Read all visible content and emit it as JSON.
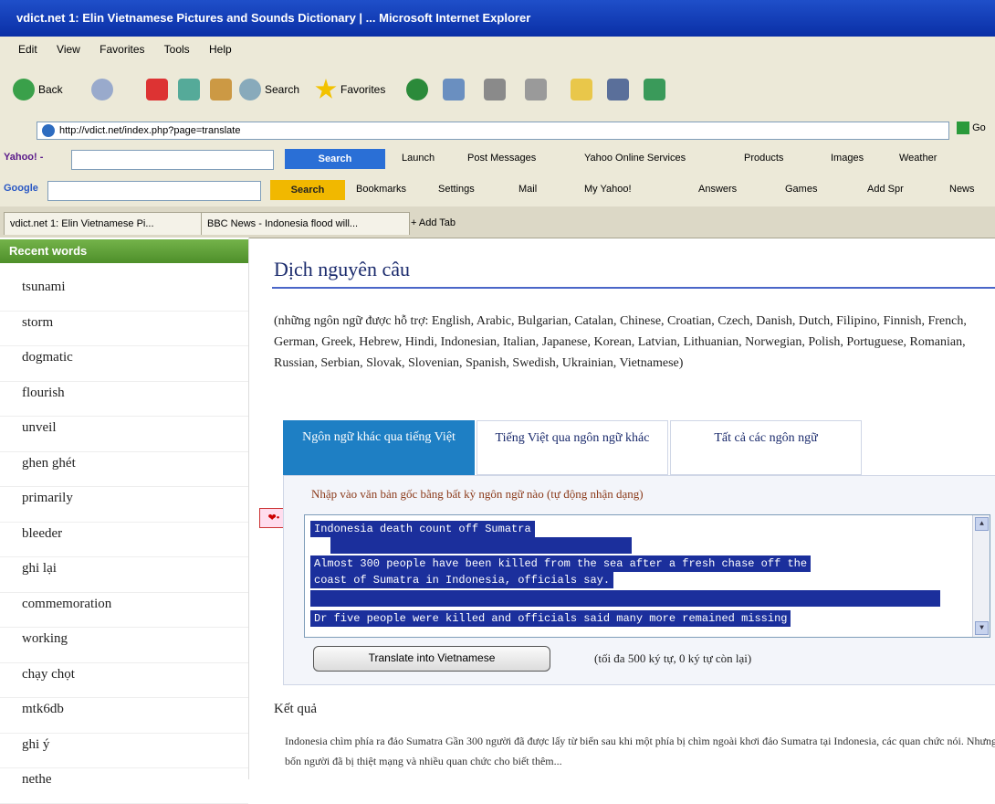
{
  "window": {
    "title": "vdict.net 1: Elin Vietnamese Pictures and Sounds Dictionary | ... Microsoft Internet Explorer"
  },
  "menu": [
    "Edit",
    "View",
    "Favorites",
    "Tools",
    "Help"
  ],
  "toolbar": {
    "back_label": "Back",
    "search_label": "Search",
    "favorites_label": "Favorites"
  },
  "address": {
    "url": "http://vdict.net/index.php?page=translate",
    "go_label": "Go"
  },
  "yahoo": {
    "label": "Yahoo! -",
    "search_button": "Search",
    "items": [
      "Launch",
      "Post Messages",
      "Yahoo Online Services",
      "Products",
      "Images",
      "Weather"
    ]
  },
  "google": {
    "label": "Google",
    "search_button": "Search",
    "items": [
      "Bookmarks",
      "Settings",
      "Mail",
      "My Yahoo!",
      "Answers",
      "Games",
      "Add Spr",
      "News"
    ]
  },
  "tabs_bar": {
    "tabs": [
      "vdict.net 1: Elin Vietnamese Pi...",
      "BBC News - Indonesia flood will..."
    ],
    "add_tab": "Add Tab"
  },
  "sidebar": {
    "heading": "Recent words",
    "words": [
      "tsunami",
      "storm",
      "dogmatic",
      "flourish",
      "unveil",
      "ghen ghét",
      "primarily",
      "bleeder",
      "ghi lại",
      "commemoration",
      "working",
      "chạy chọt",
      "mtk6db",
      "ghi ý",
      "nethe"
    ]
  },
  "main": {
    "title": "Dịch nguyên câu",
    "intro": "(những ngôn ngữ được hỗ trợ: English, Arabic, Bulgarian, Catalan, Chinese, Croatian, Czech, Danish, Dutch, Filipino, Finnish, French, German, Greek, Hebrew, Hindi, Indonesian, Italian, Japanese, Korean, Latvian, Lithuanian, Norwegian, Polish, Portuguese, Romanian, Russian, Serbian, Slovak, Slovenian, Spanish, Swedish, Ukrainian, Vietnamese)",
    "tabs": [
      "Ngôn ngữ khác qua tiếng Việt",
      "Tiếng Việt qua ngôn ngữ khác",
      "Tất cả các ngôn ngữ"
    ],
    "instruction": "Nhập vào văn bản gốc bằng bất kỳ ngôn ngữ nào (tự động nhận dạng)",
    "textarea_lines": [
      "Indonesia death count off Sumatra",
      "Almost 300 people have been killed from the sea after a fresh chase off the",
      "coast of Sumatra in Indonesia, officials say.",
      "Dr five people were killed and officials said many more remained missing"
    ],
    "translate_button": "Translate into Vietnamese",
    "limit_note": "(tối đa 500 ký tự, 0   ký tự còn lại)",
    "results_heading": "Kết quả",
    "results_text": "Indonesia chìm phía ra đảo Sumatra Gần 300 người đã được lấy từ biển sau khi một phía bị chìm ngoài khơi đảo Sumatra tại Indonesia, các quan chức nói. Nhưng bốn người đã bị thiệt mạng và nhiều quan chức cho biết thêm..."
  },
  "colors": {
    "title_bar": "#0a2fa6",
    "sidebar_head": "#4e8f2a",
    "active_tab": "#1e7fc4",
    "selection": "#1b2f9c"
  }
}
